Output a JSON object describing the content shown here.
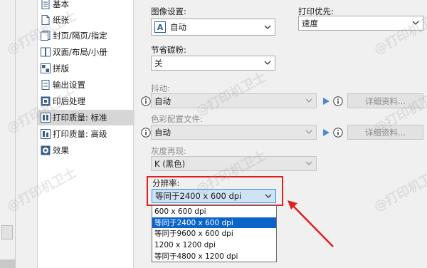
{
  "nav": {
    "items": [
      {
        "label": "基本",
        "icon": "document-icon",
        "selected": false
      },
      {
        "label": "纸张",
        "icon": "paper-icon",
        "selected": false
      },
      {
        "label": "封页/隔页/指定",
        "icon": "cover-pages-icon",
        "selected": false
      },
      {
        "label": "双面/布局/小册",
        "icon": "duplex-layout-icon",
        "selected": false
      },
      {
        "label": "拼版",
        "icon": "imposition-icon",
        "selected": false
      },
      {
        "label": "输出设置",
        "icon": "output-icon",
        "selected": false
      },
      {
        "label": "印后处理",
        "icon": "finishing-icon",
        "selected": false
      },
      {
        "label": "打印质量: 标准",
        "icon": "print-quality-icon",
        "selected": true
      },
      {
        "label": "打印质量: 高级",
        "icon": "print-quality-advanced-icon",
        "selected": false
      },
      {
        "label": "效果",
        "icon": "effects-icon",
        "selected": false
      }
    ]
  },
  "panel": {
    "image_settings_label": "图像设置:",
    "image_settings_value": "自动",
    "print_priority_label": "打印优先:",
    "print_priority_value": "速度",
    "toner_save_label": "节省碳粉:",
    "toner_save_value": "关",
    "dither_label": "抖动:",
    "dither_value": "自动",
    "dither_details": "详细资料...",
    "color_profile_label": "色彩配置文件:",
    "color_profile_value": "自动",
    "color_profile_details": "详细资料...",
    "gray_label": "灰度再现:",
    "gray_value": "K (黑色)",
    "resolution_label": "分辨率:",
    "resolution_value": "等同于2400 x 600 dpi",
    "resolution_options": [
      "600 x 600 dpi",
      "等同于2400 x 600 dpi",
      "等同于9600 x 600 dpi",
      "1200 x 1200 dpi",
      "等同于4800 x 1200 dpi"
    ],
    "resolution_selected_index": 1
  },
  "colors": {
    "highlight_border": "#e02020",
    "selection": "#0a64c8",
    "annotation_arrow": "#e02020"
  },
  "watermark": "@打印机卫士"
}
